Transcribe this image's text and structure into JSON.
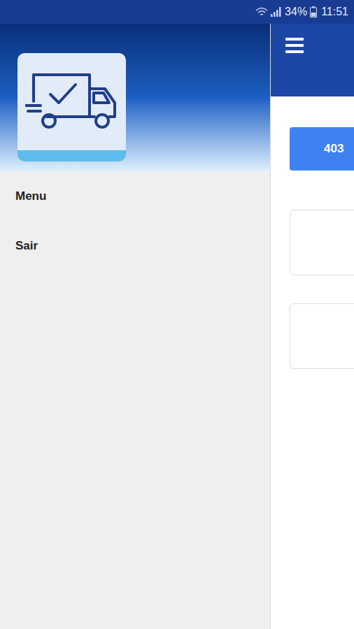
{
  "status_bar": {
    "battery": "34%",
    "time": "11:51"
  },
  "drawer": {
    "items": [
      {
        "label": "Menu"
      },
      {
        "label": "Sair"
      }
    ]
  },
  "content": {
    "button": "403"
  }
}
